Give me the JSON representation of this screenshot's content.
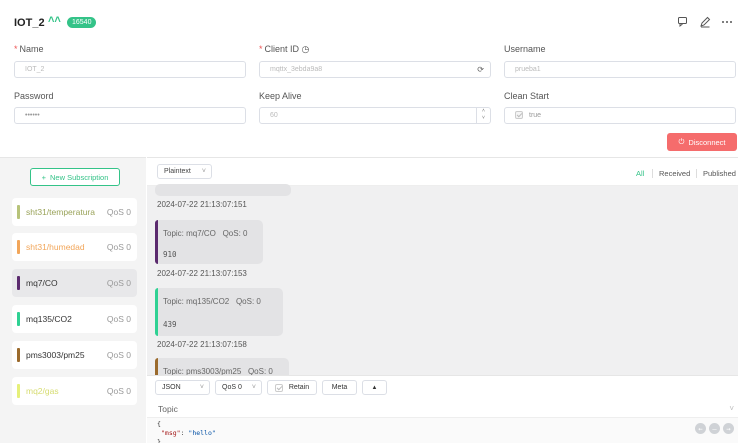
{
  "header": {
    "title": "IOT_2",
    "badge": "16540"
  },
  "form": {
    "name_label": "Name",
    "name_value": "IOT_2",
    "client_id_label": "Client ID",
    "client_id_value": "mqttx_3ebda9a8",
    "username_label": "Username",
    "username_value": "prueba1",
    "password_label": "Password",
    "password_value": "••••••",
    "keepalive_label": "Keep Alive",
    "keepalive_value": "60",
    "cleanstart_label": "Clean Start",
    "cleanstart_value": "true",
    "disconnect_label": "Disconnect"
  },
  "sidebar": {
    "new_subscription": "New Subscription",
    "items": [
      {
        "topic": "sht31/temperatura",
        "qos": "QoS 0",
        "color": "#b7c37a"
      },
      {
        "topic": "sht31/humedad",
        "qos": "QoS 0",
        "color": "#f2a65a"
      },
      {
        "topic": "mq7/CO",
        "qos": "QoS 0",
        "color": "#5b2a6e"
      },
      {
        "topic": "mq135/CO2",
        "qos": "QoS 0",
        "color": "#2fd193"
      },
      {
        "topic": "pms3003/pm25",
        "qos": "QoS 0",
        "color": "#9b6a2c"
      },
      {
        "topic": "mq2/gas",
        "qos": "QoS 0",
        "color": "#e6f07a"
      }
    ]
  },
  "messages": {
    "format": "Plaintext",
    "filters": {
      "all": "All",
      "received": "Received",
      "published": "Published"
    },
    "list": [
      {
        "timestamp": "2024-07-22 21:13:07:151"
      },
      {
        "topic": "Topic: mq7/CO",
        "qos": "QoS: 0",
        "payload": "910",
        "timestamp": "2024-07-22 21:13:07:153",
        "color": "#5b2a6e"
      },
      {
        "topic": "Topic: mq135/CO2",
        "qos": "QoS: 0",
        "payload": "439",
        "timestamp": "2024-07-22 21:13:07:158",
        "color": "#2fd193"
      },
      {
        "topic": "Topic: pms3003/pm25",
        "qos": "QoS: 0",
        "color": "#9b6a2c"
      }
    ]
  },
  "composer": {
    "payload_format": "JSON",
    "qos": "QoS 0",
    "retain": "Retain",
    "meta": "Meta",
    "topic_placeholder": "Topic",
    "payload_line1": "{",
    "payload_key": "\"msg\"",
    "payload_value": "\"hello\"",
    "payload_line3": "}"
  },
  "colors": {
    "accent": "#34c388",
    "danger": "#f56c6c"
  }
}
